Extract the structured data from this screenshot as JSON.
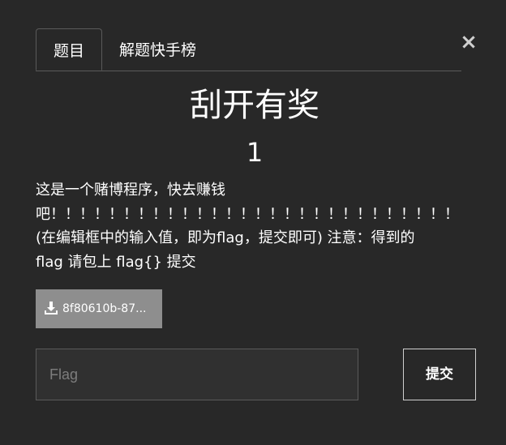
{
  "tabs": [
    {
      "label": "题目",
      "active": true
    },
    {
      "label": "解题快手榜",
      "active": false
    }
  ],
  "close_symbol": "×",
  "challenge": {
    "title": "刮开有奖",
    "points": "1",
    "description_lines": [
      "这是一个赌博程序，快去赚钱",
      "吧！！！！！！！！！！！！！！！！！！！！！！！！！！！！",
      "(在编辑框中的输入值，即为flag，提交即可) 注意：得到的",
      "flag 请包上 flag{} 提交"
    ]
  },
  "file": {
    "icon": "download-icon",
    "name": "8f80610b-87..."
  },
  "flag_input": {
    "placeholder": "Flag",
    "value": ""
  },
  "submit": {
    "label": "提交"
  },
  "colors": {
    "modal_bg": "#282828",
    "border": "#5a5a5a",
    "file_button_bg": "#8e8e8e",
    "text": "#ffffff"
  }
}
